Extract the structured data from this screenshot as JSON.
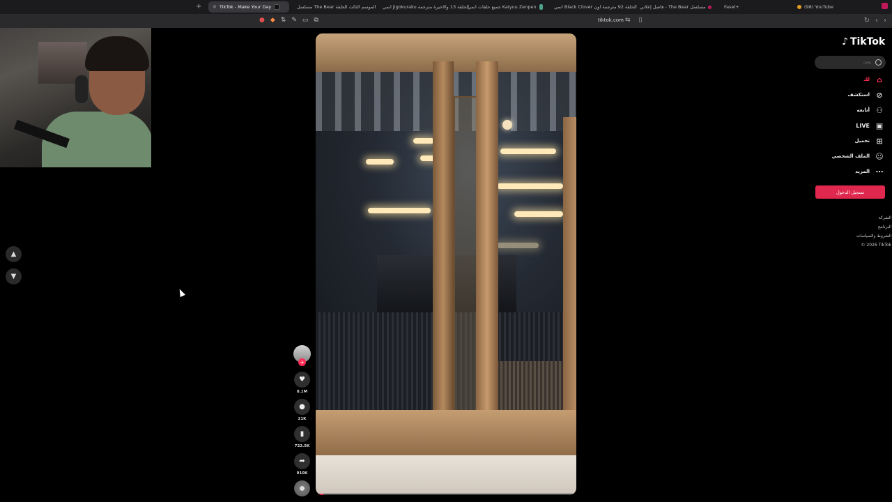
{
  "browser": {
    "tabs": [
      {
        "title": "TikTok - Make Your Day",
        "active": true
      },
      {
        "title": "مسلسل The Bear الموسم الثالث الحلقة",
        "active": false
      },
      {
        "title": "انمي Jigokuraku الحلقة 13 والاخيرة مترجمة",
        "active": false
      },
      {
        "title": "جميع حلقات انمي Kaiyuu Zenpen",
        "active": false
      },
      {
        "title": "انمي Black Clover الحلقة 92 مترجمة اون",
        "active": false
      },
      {
        "title": "فاصل إعلاني - The Bear مسلسل",
        "active": false
      },
      {
        "title": "Fasel+",
        "active": false
      },
      {
        "title": "(98) YouTube",
        "active": false
      }
    ],
    "new_tab_label": "+",
    "url": "tiktok.com"
  },
  "sidebar": {
    "logo_text": "TikTok",
    "search_placeholder": "بحث",
    "nav": [
      {
        "label": "لك",
        "icon": "home-icon",
        "active": true
      },
      {
        "label": "استكشف",
        "icon": "compass-icon",
        "active": false
      },
      {
        "label": "أتابعه",
        "icon": "following-icon",
        "active": false
      },
      {
        "label": "LIVE",
        "icon": "live-icon",
        "active": false
      },
      {
        "label": "تحميل",
        "icon": "upload-icon",
        "active": false
      },
      {
        "label": "الملف الشخصي",
        "icon": "profile-icon",
        "active": false
      },
      {
        "label": "المزيد",
        "icon": "more-icon",
        "active": false
      }
    ],
    "login_label": "تسجيل الدخول",
    "footer": [
      "الشركة",
      "البرنامج",
      "الشروط والسياسات",
      "© 2026 TikTok"
    ]
  },
  "video": {
    "actions": {
      "likes": "8.1M",
      "comments": "21K",
      "saves": "722.5K",
      "shares": "910K"
    },
    "progress": 0.03
  },
  "colors": {
    "accent": "#fe2c55",
    "login_button": "#e0284e",
    "background": "#000000"
  }
}
